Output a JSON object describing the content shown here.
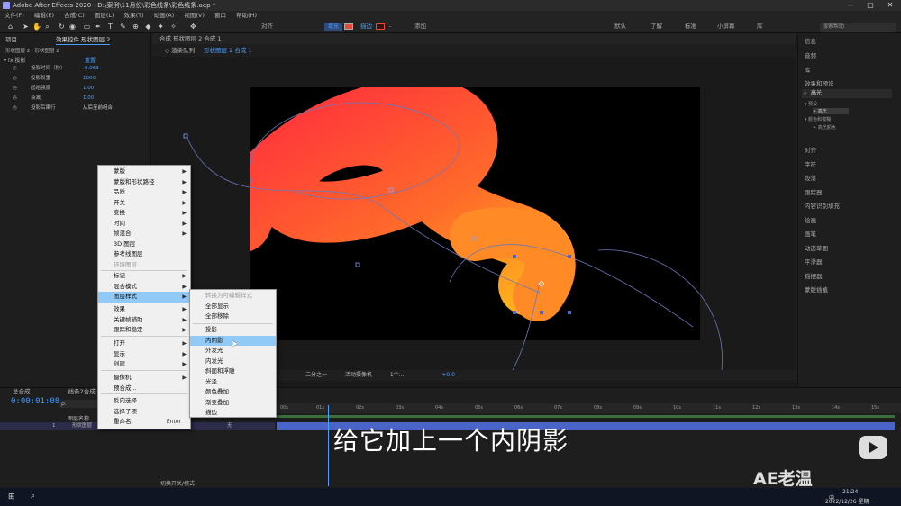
{
  "window": {
    "title": "Adobe After Effects 2020 - D:\\案例\\11月份\\彩色线条\\彩色线条.aep *",
    "min": "—",
    "max": "▢",
    "close": "✕"
  },
  "menubar": [
    "文件(F)",
    "编辑(E)",
    "合成(C)",
    "图层(L)",
    "效果(T)",
    "动画(A)",
    "视图(V)",
    "窗口",
    "帮助(H)"
  ],
  "toolbar": {
    "align": "对齐",
    "fill_label": "填充",
    "stroke_label": "描边",
    "px": "-",
    "add_label": "添加",
    "workspaces": [
      "默认",
      "了解",
      "标准",
      "小屏幕",
      "库"
    ],
    "search": "搜索帮助",
    "fill_color": "#e84a3a"
  },
  "left_panel": {
    "tab1": "项目",
    "tab2": "效果控件 形状图层 2",
    "subtitle": "形状图层 2 · 形状图层 2",
    "fx_name": "投影",
    "reset": "重置",
    "props": [
      {
        "name": "投影时间（秒）",
        "value": "-0.063"
      },
      {
        "name": "投影权重",
        "value": "1000"
      },
      {
        "name": "起始强度",
        "value": "1.00"
      },
      {
        "name": "衰减",
        "value": "1.00"
      },
      {
        "name": "投影后果行",
        "value": "从后至前组合"
      }
    ]
  },
  "comp": {
    "tab": "合成 形状图层 2 合成 1",
    "breadcrumb_left": "◇ 渲染队列",
    "breadcrumb_right": "形状图层 2 合成 1",
    "bottom": {
      "zoom": "二分之一",
      "camera": "活动摄像机",
      "views": "1个...",
      "offset": "+0.0"
    }
  },
  "right_panel": {
    "items_top": [
      "信息",
      "音频",
      "库",
      "效果和预设"
    ],
    "search": "高光",
    "tree": [
      "▾ 预设",
      "  ✦ 高光",
      "▾ 颜色和模糊",
      "  ✦ 高光颜色"
    ],
    "items_bottom": [
      "对齐",
      "字符",
      "段落",
      "跟踪器",
      "内容识别填充",
      "绘画",
      "画笔",
      "动态草图",
      "平滑器",
      "摇摆器",
      "蒙版插值"
    ]
  },
  "timeline": {
    "tab1": "总合成",
    "tab2": "线条2合成",
    "timecode": "0:00:01:08",
    "search": "ρ.",
    "col_header": "图层名称",
    "layer_num": "1",
    "layer_name": "形状图层",
    "layer_mode": "无",
    "toggle": "切换开关/模式",
    "ruler": [
      "00s",
      "01s",
      "02s",
      "03s",
      "04s",
      "05s",
      "06s",
      "07s",
      "08s",
      "09s",
      "10s",
      "11s",
      "12s",
      "13s",
      "14s",
      "15s"
    ]
  },
  "context_menu": [
    {
      "label": "蒙版",
      "sub": true
    },
    {
      "label": "蒙版和形状路径",
      "sub": true
    },
    {
      "label": "品质",
      "sub": true
    },
    {
      "label": "开关",
      "sub": true
    },
    {
      "label": "变换",
      "sub": true
    },
    {
      "label": "时间",
      "sub": true
    },
    {
      "label": "帧混合",
      "sub": true
    },
    {
      "label": "3D 图层",
      "sub": false
    },
    {
      "label": "参考线图层",
      "sub": false
    },
    {
      "label": "环境图层",
      "sub": false,
      "disabled": true
    },
    {
      "label": "标记",
      "sub": true
    },
    {
      "label": "混合模式",
      "sub": true
    },
    {
      "label": "图层样式",
      "sub": true,
      "highlight": true
    },
    {
      "label": "效果",
      "sub": true
    },
    {
      "label": "关键帧辅助",
      "sub": true
    },
    {
      "label": "跟踪和稳定",
      "sub": true
    },
    {
      "label": "打开",
      "sub": true
    },
    {
      "label": "显示",
      "sub": true
    },
    {
      "label": "创建",
      "sub": true
    },
    {
      "label": "摄像机",
      "sub": true
    },
    {
      "label": "预合成...",
      "sub": false
    },
    {
      "label": "反向选择",
      "sub": false
    },
    {
      "label": "选择子项",
      "sub": false
    },
    {
      "label": "重命名",
      "sub": false,
      "shortcut": "Enter"
    }
  ],
  "sub_menu": [
    {
      "label": "转换为可编辑样式",
      "disabled": true
    },
    {
      "label": "全部显示"
    },
    {
      "label": "全部移除"
    },
    {
      "label": "投影"
    },
    {
      "label": "内阴影",
      "highlight": true
    },
    {
      "label": "外发光"
    },
    {
      "label": "内发光"
    },
    {
      "label": "斜面和浮雕"
    },
    {
      "label": "光泽"
    },
    {
      "label": "颜色叠加"
    },
    {
      "label": "渐变叠加"
    },
    {
      "label": "描边"
    }
  ],
  "overlay": {
    "subtitle": "给它加上一个内阴影",
    "watermark": "AE老温"
  },
  "taskbar": {
    "time": "21:24",
    "date": "2022/12/26 星期一",
    "lang": "中"
  },
  "colors": {
    "accent": "#3c9cff",
    "menu_highlight": "#91c9f7",
    "tube_start": "#ff3a3a",
    "tube_end": "#ffb020"
  }
}
